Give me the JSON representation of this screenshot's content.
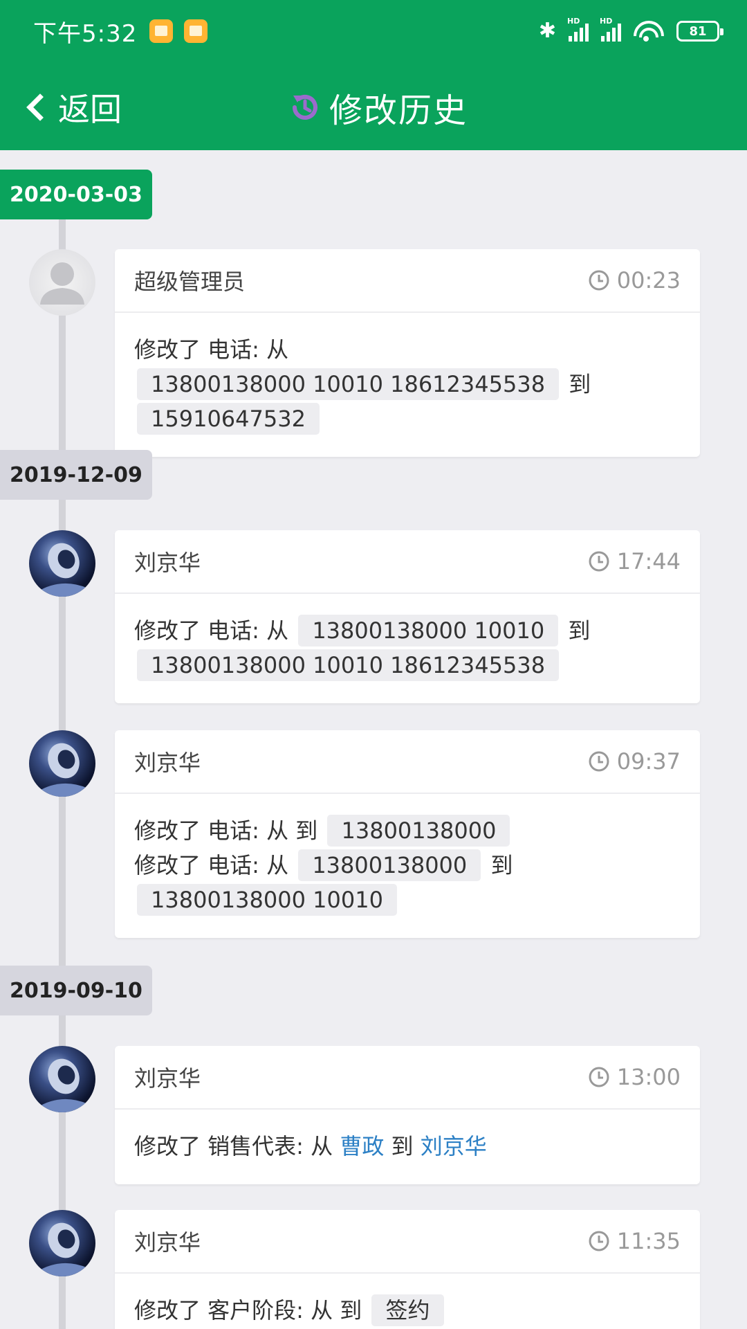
{
  "status": {
    "time": "下午5:32",
    "battery": "81",
    "hd": "HD"
  },
  "nav": {
    "back_label": "返回",
    "title": "修改历史"
  },
  "colors": {
    "brand": "#0aa35c",
    "link": "#2c80c5",
    "history_icon": "#9b6bcc"
  },
  "groups": [
    {
      "date": "2020-03-03",
      "entries": [
        {
          "author": "超级管理员",
          "time": "00:23",
          "lines": [
            [
              "修改了 电话: 从",
              "13800138000 10010 18612345538",
              "到",
              "15910647532"
            ]
          ]
        }
      ]
    },
    {
      "date": "2019-12-09",
      "entries": [
        {
          "author": "刘京华",
          "time": "17:44",
          "lines": [
            [
              "修改了 电话: 从",
              "13800138000 10010",
              "到",
              "13800138000 10010 18612345538"
            ]
          ]
        },
        {
          "author": "刘京华",
          "time": "09:37",
          "lines": [
            [
              "修改了 电话: 从 到",
              "13800138000"
            ],
            [
              "修改了 电话: 从",
              "13800138000",
              "到",
              "13800138000 10010"
            ]
          ]
        }
      ]
    },
    {
      "date": "2019-09-10",
      "entries": [
        {
          "author": "刘京华",
          "time": "13:00",
          "lines": [
            [
              "修改了 销售代表: 从",
              "曹政",
              "到",
              "刘京华"
            ]
          ]
        },
        {
          "author": "刘京华",
          "time": "11:35",
          "lines": [
            [
              "修改了 客户阶段: 从 到",
              "签约"
            ]
          ]
        }
      ]
    }
  ]
}
